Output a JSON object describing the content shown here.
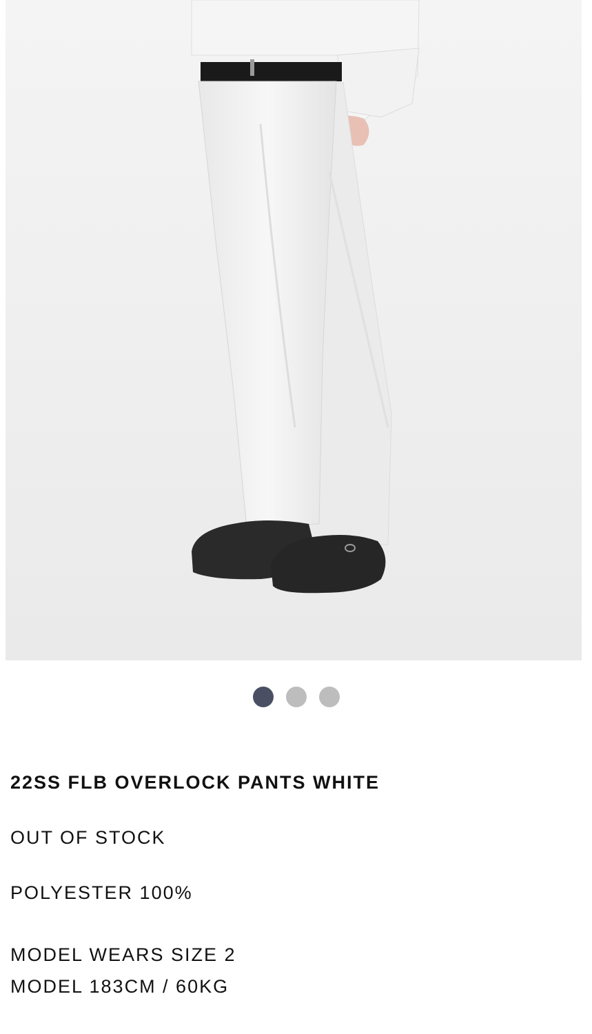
{
  "product": {
    "title": "22SS FLB OVERLOCK PANTS WHITE",
    "stock_status": "OUT OF STOCK",
    "material": "POLYESTER 100%",
    "model_size": "MODEL WEARS SIZE 2",
    "model_measurements": "MODEL 183CM / 60KG"
  },
  "gallery": {
    "image_alt": "22SS FLB OVERLOCK PANTS WHITE",
    "slide_count": 3,
    "active_slide": 1
  },
  "colors": {
    "dot_active": "#4b4f63",
    "dot_inactive": "#bdbdbd"
  }
}
